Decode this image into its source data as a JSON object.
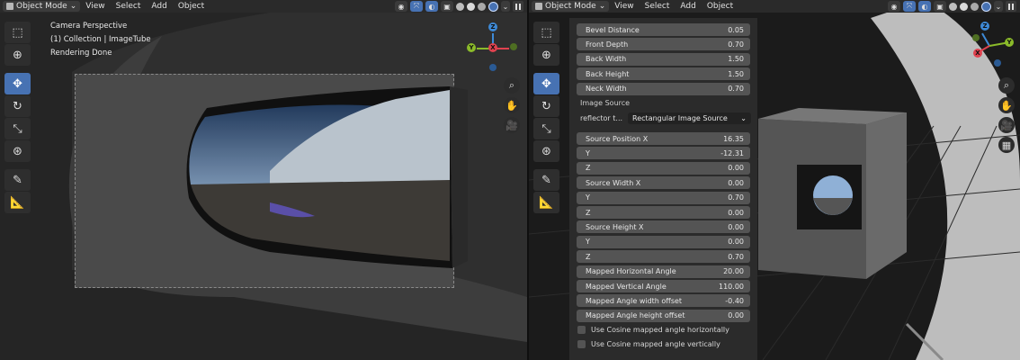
{
  "left": {
    "mode": "Object Mode",
    "menus": [
      "View",
      "Select",
      "Add",
      "Object"
    ],
    "overlay": {
      "perspective": "Camera Perspective",
      "collection": "(1) Collection | ImageTube",
      "status": "Rendering Done"
    },
    "gizmo": {
      "x": "X",
      "y": "Y",
      "z": "Z"
    }
  },
  "right": {
    "mode": "Object Mode",
    "menus": [
      "View",
      "Select",
      "Add",
      "Object"
    ],
    "gizmo": {
      "x": "X",
      "y": "Y",
      "z": "Z"
    },
    "props": [
      {
        "label": "Bevel Distance",
        "value": "0.05"
      },
      {
        "label": "Front Depth",
        "value": "0.70"
      },
      {
        "label": "Back Width",
        "value": "1.50"
      },
      {
        "label": "Back Height",
        "value": "1.50"
      },
      {
        "label": "Neck Width",
        "value": "0.70"
      }
    ],
    "image_source_label": "Image Source",
    "reflector_label": "reflector t...",
    "reflector_value": "Rectangular Image Source",
    "props2": [
      {
        "label": "Source Position X",
        "value": "16.35"
      },
      {
        "label": "Y",
        "value": "-12.31"
      },
      {
        "label": "Z",
        "value": "0.00"
      },
      {
        "label": "Source Width X",
        "value": "0.00"
      },
      {
        "label": "Y",
        "value": "0.70"
      },
      {
        "label": "Z",
        "value": "0.00"
      },
      {
        "label": "Source Height X",
        "value": "0.00"
      },
      {
        "label": "Y",
        "value": "0.00"
      },
      {
        "label": "Z",
        "value": "0.70"
      },
      {
        "label": "Mapped Horizontal Angle",
        "value": "20.00"
      },
      {
        "label": "Mapped Vertical Angle",
        "value": "110.00"
      },
      {
        "label": "Mapped Angle width offset",
        "value": "-0.40"
      },
      {
        "label": "Mapped Angle height offset",
        "value": "0.00"
      }
    ],
    "checkboxes": [
      {
        "label": "Use Cosine mapped angle horizontally",
        "checked": false
      },
      {
        "label": "Use Cosine mapped angle vertically",
        "checked": false
      }
    ]
  },
  "colors": {
    "accent": "#4772b3",
    "x_axis": "#e0424f",
    "y_axis": "#8bbb2a",
    "z_axis": "#3e8ad7"
  }
}
